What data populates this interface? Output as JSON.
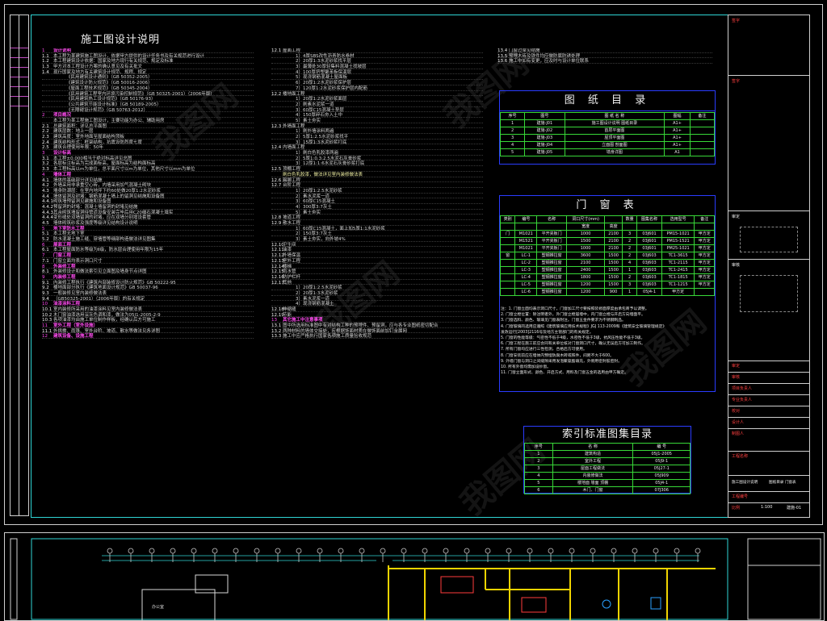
{
  "sheet": {
    "title": "施工图设计说明"
  },
  "column1": [
    {
      "n": "1",
      "t": "设计说明",
      "k": "h"
    },
    {
      "n": "1.1",
      "t": "本工程为某建筑施工图设计，依据甲方提供的设计任务书及有关规范进行设计"
    },
    {
      "n": "1.2",
      "t": "本工程建筑设计依据：国家及地方现行有关规范、规定及标准"
    },
    {
      "n": "1.3",
      "t": "甲方对本工程设计方案的确认意见及有关批文"
    },
    {
      "n": "1.4",
      "t": "现行国家及地方有关建筑设计规范、规程、规定"
    },
    {
      "n": "",
      "t": "《民用建筑设计通则》（GB 50352-2005）",
      "k": "sub"
    },
    {
      "n": "",
      "t": "《建筑设计防火规范》（GB 50016-2006）",
      "k": "sub"
    },
    {
      "n": "",
      "t": "《屋面工程技术规范》（GB 50345-2004）",
      "k": "sub"
    },
    {
      "n": "",
      "t": "《民用建筑工程室内环境污染控制规范》（GB 50325-2001）（2006年版）",
      "k": "sub"
    },
    {
      "n": "",
      "t": "《民用建筑热工设计规范》（GB 50176-93）",
      "k": "sub"
    },
    {
      "n": "",
      "t": "《公共建筑节能设计标准》（GB 50189-2005）",
      "k": "sub"
    },
    {
      "n": "",
      "t": "《无障碍设计规范》（GB 50763-2012）",
      "k": "sub"
    },
    {
      "n": "2",
      "t": "项目概况",
      "k": "h"
    },
    {
      "n": "",
      "t": "本工程为某工程施工图设计，主要功能为办公、辅助用房"
    },
    {
      "n": "2.1",
      "t": "总建筑面积：详见总平面图"
    },
    {
      "n": "2.2",
      "t": "建筑层数：地上一层"
    },
    {
      "n": "2.3",
      "t": "建筑高度：室外地面至屋面结构顶板"
    },
    {
      "n": "2.4",
      "t": "建筑结构形式：框架结构，抗震设防烈度七度"
    },
    {
      "n": "2.5",
      "t": "建筑合理使用年限：50年"
    },
    {
      "n": "3",
      "t": "设计标高",
      "k": "h"
    },
    {
      "n": "3.1",
      "t": "本工程±0.000相当于绝对标高详见总图"
    },
    {
      "n": "3.2",
      "t": "各层标注标高为完成面标高，屋面标高为结构面标高"
    },
    {
      "n": "3.3",
      "t": "本工程标高以m为单位，总平面尺寸以m为单位，其他尺寸以mm为单位"
    },
    {
      "n": "4",
      "t": "墙体工程",
      "k": "h"
    },
    {
      "n": "4.1",
      "t": "墙体的基础部分详见结施"
    },
    {
      "n": "4.2",
      "t": "外墙采用非承重空心砖，内墙采用加气混凝土砌块"
    },
    {
      "n": "4.3",
      "t": "墙身防潮层：在室内地坪下约60处做20厚1:2水泥砂浆"
    },
    {
      "n": "4.4",
      "t": "墙体留洞及封堵：钢筋混凝土墙上的留洞见结施和设备图"
    },
    {
      "n": "4.4.1",
      "t": "砌筑墙预留洞见建施和设备图"
    },
    {
      "n": "4.4.2",
      "t": "预留洞的封堵：混凝土墙留洞的封堵见结施"
    },
    {
      "n": "4.4.3",
      "t": "其余砌筑墙留洞待管道设备安装完毕后用C20细石混凝土填实"
    },
    {
      "n": "4.4.4",
      "t": "变形缝处双墙留洞的封堵，应在双墙分别增设套管"
    },
    {
      "n": "4.5",
      "t": "墙体砌筑砂浆及强度等级详见结构设计说明"
    },
    {
      "n": "5",
      "t": "地下室防水工程",
      "k": "h"
    },
    {
      "n": "5.1",
      "t": "本工程无地下室"
    },
    {
      "n": "5.2",
      "t": "防水混凝土施工缝、穿墙管等细部构造做法详见图集"
    },
    {
      "n": "6",
      "t": "屋面工程",
      "k": "h"
    },
    {
      "n": "6.1",
      "t": "本工程屋面防水等级为Ⅱ级，防水层合理使用年限为15年"
    },
    {
      "n": "7",
      "t": "门窗工程",
      "k": "h"
    },
    {
      "n": "7.1",
      "t": "门窗立面均表示洞口尺寸"
    },
    {
      "n": "8",
      "t": "外装修工程",
      "k": "h"
    },
    {
      "n": "8.1",
      "t": "外装修设计和做法索引见立面图及墙身节点详图"
    },
    {
      "n": "9",
      "t": "内装修工程",
      "k": "h"
    },
    {
      "n": "9.1",
      "t": "内装修工程执行《建筑内部装修设计防火规范》GB 50222-95"
    },
    {
      "n": "9.2",
      "t": "楼地面部分执行《建筑地面设计规范》GB 50037-96"
    },
    {
      "n": "9.3",
      "t": "一般装修见室内装修做法表"
    },
    {
      "n": "9.4",
      "t": "（GB50325-2001）（2006年版）的有关规定"
    },
    {
      "n": "10",
      "t": "油漆涂料工程",
      "k": "h"
    },
    {
      "n": "10.1",
      "t": "室内装修所采用的油漆涂料见室内装修做法表"
    },
    {
      "n": "10.2",
      "t": "木门窗油漆选用深灰色调和漆，做法为05J1-2005-2-9"
    },
    {
      "n": "10.3",
      "t": "各项油漆均由施工单位制作样板，经确认后方可施工"
    },
    {
      "n": "11",
      "t": "室外工程（室外设施）",
      "k": "h"
    },
    {
      "n": "11.1",
      "t": "外挑檐、雨篷、室外台阶、坡道、散水等做法见各详图"
    },
    {
      "n": "12",
      "t": "建筑设备、设施工程",
      "k": "h"
    }
  ],
  "column2": [
    {
      "n": "12.1",
      "t": "屋面工程"
    },
    {
      "n": "",
      "t": "1）4厚SBS改性沥青防水卷材",
      "k": "sub"
    },
    {
      "n": "",
      "t": "2）20厚1:3水泥砂浆找平层",
      "k": "sub"
    },
    {
      "n": "",
      "t": "3）最薄处30厚轻集料混凝土找坡层",
      "k": "sub"
    },
    {
      "n": "",
      "t": "4）100厚挤塑聚苯板保温层",
      "k": "sub"
    },
    {
      "n": "",
      "t": "5）现浇钢筋混凝土屋面板",
      "k": "sub"
    },
    {
      "n": "",
      "t": "6）20厚1:2水泥砂浆保护层",
      "k": "sub"
    },
    {
      "n": "",
      "t": "7）120厚1:2水泥砂浆保护层内配筋",
      "k": "sub"
    },
    {
      "n": "12.2",
      "t": "楼地面工程"
    },
    {
      "n": "",
      "t": "1）20厚1:2水泥砂浆面层",
      "k": "sub"
    },
    {
      "n": "",
      "t": "2）刷素水泥浆一道",
      "k": "sub"
    },
    {
      "n": "",
      "t": "3）60厚C15混凝土垫层",
      "k": "sub"
    },
    {
      "n": "",
      "t": "4）150厚碎石夯入土中",
      "k": "sub"
    },
    {
      "n": "",
      "t": "5）素土夯实",
      "k": "sub"
    },
    {
      "n": "12.3",
      "t": "外墙面工程"
    },
    {
      "n": "",
      "t": "1）刷外墙涂料两遍",
      "k": "sub"
    },
    {
      "n": "",
      "t": "2）5厚1:2.5水泥砂浆找平",
      "k": "sub"
    },
    {
      "n": "",
      "t": "3）15厚1:3水泥砂浆打底",
      "k": "sub"
    },
    {
      "n": "12.4",
      "t": "内墙面工程"
    },
    {
      "n": "",
      "t": "1）刷白色乳胶漆两遍",
      "k": "sub"
    },
    {
      "n": "",
      "t": "2）5厚1:0.3:2.5水泥石灰膏砂浆",
      "k": "sub"
    },
    {
      "n": "",
      "t": "3）12厚1:1:6水泥石灰膏砂浆打底",
      "k": "sub"
    },
    {
      "n": "12.5",
      "t": "顶棚工程"
    },
    {
      "n": "",
      "t": "刷白色乳胶漆，做法详见室内装修做法表",
      "k": "s"
    },
    {
      "n": "12.6",
      "t": "踢脚工程"
    },
    {
      "n": "12.7",
      "t": "台阶工程"
    },
    {
      "n": "",
      "t": "1）20厚1:2.5水泥砂浆",
      "k": "sub"
    },
    {
      "n": "",
      "t": "2）素水泥浆一道",
      "k": "sub"
    },
    {
      "n": "",
      "t": "3）60厚C15混凝土",
      "k": "sub"
    },
    {
      "n": "",
      "t": "4）300厚3:7灰土",
      "k": "sub"
    },
    {
      "n": "",
      "t": "5）素土夯实",
      "k": "sub"
    },
    {
      "n": "12.8",
      "t": "坡道工程"
    },
    {
      "n": "12.9",
      "t": "散水工程"
    },
    {
      "n": "",
      "t": "1）60厚C15混凝土，面上加5厚1:1水泥砂浆",
      "k": "sub"
    },
    {
      "n": "",
      "t": "2）150厚3:7灰土",
      "k": "sub"
    },
    {
      "n": "",
      "t": "3）素土夯实，向外坡4%",
      "k": "sub"
    },
    {
      "n": "12.10",
      "t": "卫生间"
    },
    {
      "n": "12.11",
      "t": "油漆"
    },
    {
      "n": "12.12",
      "t": "外墙保温"
    },
    {
      "n": "12.13",
      "t": "室外工程"
    },
    {
      "n": "12.14",
      "t": "楼梯"
    },
    {
      "n": "12.15",
      "t": "雨水管"
    },
    {
      "n": "12.16",
      "t": "防护栏杆"
    },
    {
      "n": "12.17",
      "t": "其他"
    },
    {
      "n": "",
      "t": "1）20厚1:2.5水泥砂浆",
      "k": "sub"
    },
    {
      "n": "",
      "t": "2）20厚1:3水泥砂浆",
      "k": "sub"
    },
    {
      "n": "",
      "t": "3）素水泥浆一道",
      "k": "sub"
    },
    {
      "n": "",
      "t": "4）现浇钢筋混凝土",
      "k": "sub"
    },
    {
      "n": "12.18",
      "t": "伸缩缝"
    },
    {
      "n": "12.19",
      "t": "节能"
    },
    {
      "n": "13",
      "t": "其它施工中注意事项",
      "k": "h"
    },
    {
      "n": "13.1",
      "t": "图中所选用标准图中有对结构工种的预埋件、预留洞，应与各专业图纸密切配合"
    },
    {
      "n": "13.2",
      "t": "两种材料的墙体交接处，应根据饰面材质在做饰面前加钉金属网"
    },
    {
      "n": "13.3",
      "t": "施工中应严格执行国家各项施工质量验收规范"
    }
  ],
  "column3_top": [
    {
      "n": "13.4",
      "t": "门窗过梁见结施"
    },
    {
      "n": "13.5",
      "t": "预埋木砖及铁件均应做防腐防锈处理"
    },
    {
      "n": "13.6",
      "t": "施工中如有变更，应及时与设计单位联系"
    }
  ],
  "drawing_list": {
    "title": "图 纸 目 录",
    "headers": [
      "序号",
      "图号",
      "图 纸 名 称",
      "图幅",
      "备注"
    ],
    "rows": [
      [
        "1",
        "建施-J01",
        "施工图设计说明 图纸目录",
        "A1+",
        ""
      ],
      [
        "2",
        "建施-J02",
        "首层平面图",
        "A1+",
        ""
      ],
      [
        "3",
        "建施-J03",
        "屋顶平面图",
        "A1+",
        ""
      ],
      [
        "4",
        "建施-J04",
        "立面图 剖面图",
        "A1+",
        ""
      ],
      [
        "5",
        "建施-J05",
        "墙身详图",
        "A1",
        ""
      ]
    ]
  },
  "door_table": {
    "title": "门 窗 表",
    "headers": [
      "类别",
      "编号",
      "名称",
      "洞口尺寸(mm)",
      "",
      "数量",
      "图集名称",
      "选用型号",
      "备注"
    ],
    "subheaders": [
      "",
      "",
      "",
      "宽度",
      "高度",
      "",
      "",
      "",
      ""
    ],
    "rows": [
      [
        "门",
        "M1021",
        "平开夹板门",
        "1000",
        "2100",
        "3",
        "03J601",
        "PM15-1021",
        "甲方定"
      ],
      [
        "",
        "M1521",
        "平开夹板门",
        "1500",
        "2100",
        "2",
        "03J601",
        "PM15-1521",
        "甲方定"
      ],
      [
        "",
        "M1021",
        "平开夹板门",
        "1000",
        "2100",
        "2",
        "03J601",
        "PM25-1021",
        "甲方定"
      ],
      [
        "窗",
        "LC-1",
        "塑钢推拉窗",
        "3600",
        "1500",
        "2",
        "03J603",
        "TC1-3615",
        "甲方定"
      ],
      [
        "",
        "LC-2",
        "塑钢推拉窗",
        "2100",
        "1500",
        "4",
        "03J603",
        "TC1-2115",
        "甲方定"
      ],
      [
        "",
        "LC-3",
        "塑钢推拉窗",
        "2400",
        "1500",
        "1",
        "03J603",
        "TC1-2415",
        "甲方定"
      ],
      [
        "",
        "LC-4",
        "塑钢推拉窗",
        "1800",
        "1500",
        "2",
        "03J603",
        "TC1-1815",
        "甲方定"
      ],
      [
        "",
        "LC-5",
        "塑钢推拉窗",
        "1200",
        "1500",
        "3",
        "03J603",
        "TC1-1215",
        "甲方定"
      ],
      [
        "",
        "LC-6",
        "塑钢推拉窗",
        "1200",
        "900",
        "1",
        "05J4-1",
        "甲方定",
        ""
      ]
    ]
  },
  "notes": [
    "注：1. 门窗立面均表示洞口尺寸，门窗加工尺寸要按照装修面厚度由承包商予以调整。",
    "2. 门窗立樘位置：除注明者外，外门窗立樘居墙中，内门窗立樘与开启方向墙面平。",
    "3. 门窗选料、颜色、玻璃见门窗表附注。门窗五金件要求为不锈钢制品。",
    "4. 门窗玻璃的选用应遵照《建筑玻璃应用技术规程》JGJ 113-2009和《建筑安全玻璃管理规定》",
    "   发改运行[2003]2116号及地方主管部门的有关规定。",
    "5. 门窗的性能等级：气密性不低于4级，水密性不低于3级，抗风压性能不低于3级。",
    "6. 门窗工程在施工前应会同有关单位核对门窗洞口尺寸，确认无误后方可加工制作。",
    "7. 所有门窗均应进行三性检测，合格后方可使用。",
    "8. 门窗安装前应在墙体内预埋防腐木砖或铁件，间距不大于600。",
    "9. 外墙门窗与洞口之间缝隙采用发泡聚氨酯填充，外侧用密封胶密封。",
    "10. 所有外窗均需加设纱窗。",
    "11. 门窗立面形式、颜色、开启方式、用料及门窗五金的选用由甲方确定。"
  ],
  "atlas_list": {
    "title": "索引标准图集目录",
    "headers": [
      "序号",
      "名 称",
      "编 号"
    ],
    "rows": [
      [
        "1",
        "建筑构造",
        "05J1-2005"
      ],
      [
        "2",
        "室外工程",
        "05J9-1"
      ],
      [
        "3",
        "屋面工程做法",
        "05J27-1"
      ],
      [
        "4",
        "内装修做法",
        "05J909"
      ],
      [
        "5",
        "楼地面 墙面 顶棚",
        "05J4-1"
      ],
      [
        "6",
        "木门、门窗",
        "07J306"
      ]
    ]
  },
  "title_block": {
    "r1": "签字",
    "r2": "签字",
    "r3": "审定",
    "r4": "审核",
    "r5": "项目负责人",
    "r6": "专业负责人",
    "r7": "校对",
    "r8": "设计人",
    "r9": "制图人",
    "r10": "工程名称",
    "r11": "图纸名称",
    "project": "施工图设计说明",
    "drawing_name": "图纸目录 门窗表",
    "r12": "工程编号",
    "r13": "比例",
    "scale": "1:100",
    "r14": "日期",
    "r15": "图号",
    "sheet_no": "建施-01",
    "approve": "审定",
    "check": "审核",
    "review": "校对"
  },
  "plan": {
    "labels": [
      "办公室",
      "会议室",
      "卫生间",
      "走廊",
      "值班室"
    ]
  },
  "watermark": "我图网"
}
